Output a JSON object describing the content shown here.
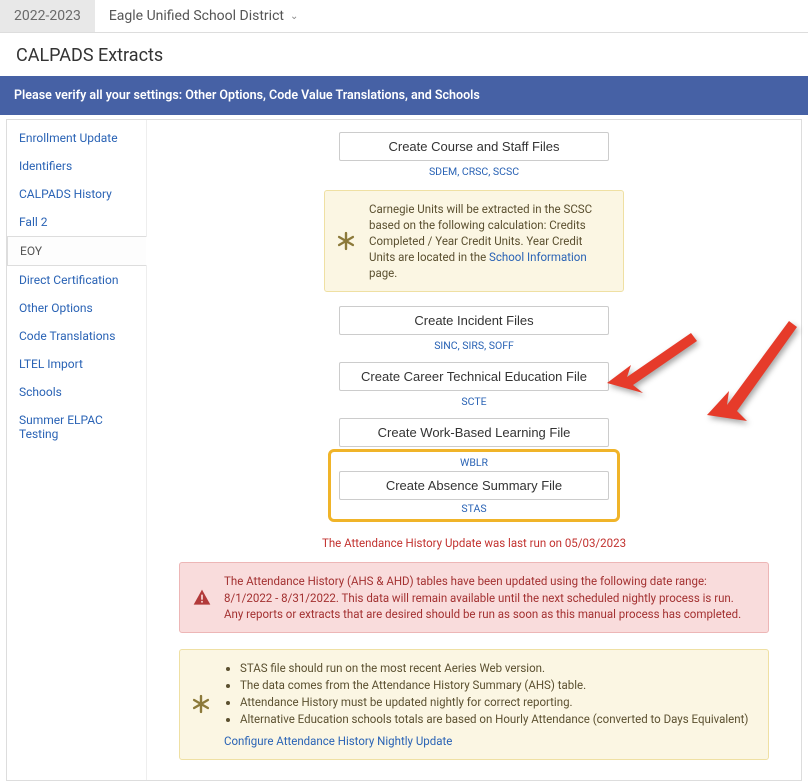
{
  "topbar": {
    "year": "2022-2023",
    "district": "Eagle Unified School District"
  },
  "page_title": "CALPADS Extracts",
  "verify_banner": "Please verify all your settings: Other Options, Code Value Translations, and Schools",
  "sidebar": {
    "items": [
      {
        "label": "Enrollment Update"
      },
      {
        "label": "Identifiers"
      },
      {
        "label": "CALPADS History"
      },
      {
        "label": "Fall 2"
      },
      {
        "label": "EOY"
      },
      {
        "label": "Direct Certification"
      },
      {
        "label": "Other Options"
      },
      {
        "label": "Code Translations"
      },
      {
        "label": "LTEL Import"
      },
      {
        "label": "Schools"
      },
      {
        "label": "Summer ELPAC Testing"
      }
    ],
    "active_index": 4
  },
  "buttons": {
    "course_staff": "Create Course and Staff Files",
    "course_staff_codes": "SDEM, CRSC, SCSC",
    "incident": "Create Incident Files",
    "incident_codes": "SINC, SIRS, SOFF",
    "cte": "Create Career Technical Education File",
    "cte_codes": "SCTE",
    "wbl": "Create Work-Based Learning File",
    "wbl_codes": "WBLR",
    "absence": "Create Absence Summary File",
    "absence_codes": "STAS"
  },
  "carnegie_note": {
    "line1": "Carnegie Units will be extracted in the SCSC based on the following calculation: Credits Completed / Year Credit Units. Year Credit Units are located in the ",
    "link": "School Information",
    "line2": " page."
  },
  "attendance_status": "The Attendance History Update was last run on 05/03/2023",
  "alert_text": "The Attendance History (AHS & AHD) tables have been updated using the following date range: 8/1/2022 - 8/31/2022. This data will remain available until the next scheduled nightly process is run. Any reports or extracts that are desired should be run as soon as this manual process has completed.",
  "notes": {
    "items": [
      "STAS file should run on the most recent Aeries Web version.",
      "The data comes from the Attendance History Summary (AHS) table.",
      "Attendance History must be updated nightly for correct reporting.",
      "Alternative Education schools totals are based on Hourly Attendance (converted to Days Equivalent)"
    ],
    "link": "Configure Attendance History Nightly Update"
  },
  "colors": {
    "accent_blue": "#2a63b5",
    "banner_blue": "#4661a5",
    "highlight_orange": "#f0b429",
    "alert_red": "#c2322f",
    "arrow_red": "#e63b2a"
  }
}
